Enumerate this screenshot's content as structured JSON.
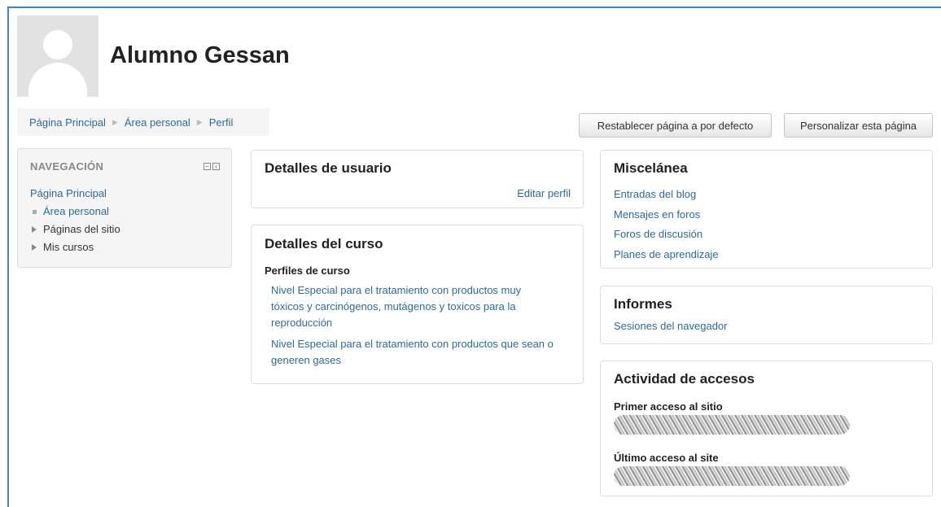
{
  "profile": {
    "name": "Alumno Gessan"
  },
  "breadcrumb": [
    "Página Principal",
    "Área personal",
    "Perfil"
  ],
  "buttons": {
    "reset": "Restablecer página a por defecto",
    "customize": "Personalizar esta página"
  },
  "navigation": {
    "title": "NAVEGACIÓN",
    "home": "Página Principal",
    "items": [
      "Área personal",
      "Páginas del sitio",
      "Mis cursos"
    ]
  },
  "user_details": {
    "title": "Detalles de usuario",
    "edit_link": "Editar perfil"
  },
  "course_details": {
    "title": "Detalles del curso",
    "subtitle": "Perfiles de curso",
    "courses": [
      "Nivel Especial para el tratamiento con productos muy tóxicos y carcinógenos, mutágenos y toxicos para la reproducción",
      "Nivel Especial para el tratamiento con productos que sean o generen gases"
    ]
  },
  "misc": {
    "title": "Miscelánea",
    "links": [
      "Entradas del blog",
      "Mensajes en foros",
      "Foros de discusión",
      "Planes de aprendizaje"
    ]
  },
  "reports": {
    "title": "Informes",
    "links": [
      "Sesiones del navegador"
    ]
  },
  "access": {
    "title": "Actividad de accesos",
    "first_label": "Primer acceso al sitio",
    "last_label": "Último acceso al site"
  },
  "colors": {
    "link": "#2b6b9a",
    "frame": "#3f84c5",
    "block_bg": "#f5f5f5"
  }
}
